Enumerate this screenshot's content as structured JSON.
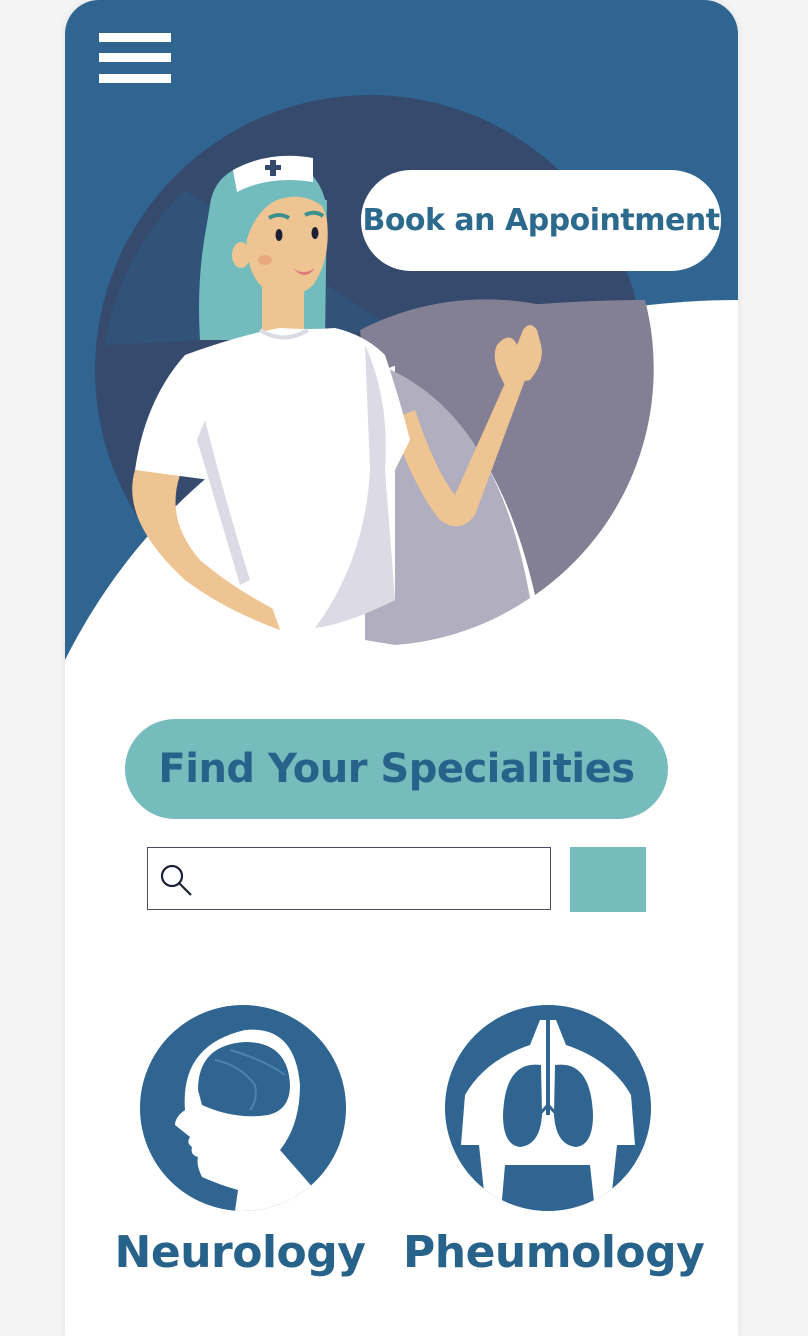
{
  "header": {
    "menu_icon": "hamburger-menu-icon",
    "book_label": "Book an Appointment"
  },
  "hero": {
    "illustration": "nurse-illustration"
  },
  "find": {
    "title": "Find Your Specialities"
  },
  "search": {
    "icon": "search-icon",
    "value": "",
    "placeholder": ""
  },
  "specialties": [
    {
      "label": "Neurology",
      "icon": "brain-head-icon"
    },
    {
      "label": "Pheumology",
      "icon": "lungs-icon"
    }
  ],
  "colors": {
    "primary": "#2f6590",
    "dark": "#364a6d",
    "teal": "#76bcbc",
    "text": "#27628a",
    "grey": "#b0aebf",
    "grey_dark": "#837f94",
    "white": "#ffffff"
  }
}
